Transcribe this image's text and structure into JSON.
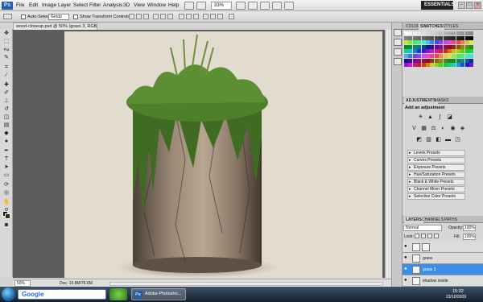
{
  "app": {
    "logo": "Ps"
  },
  "menu": [
    "File",
    "Edit",
    "Image",
    "Layer",
    "Select",
    "Filter",
    "Analysis",
    "3D",
    "View",
    "Window",
    "Help"
  ],
  "top_toolbar": {
    "zoom": "33%",
    "workspace": "ESSENTIALS ▾",
    "window_buttons": [
      "–",
      "□",
      "×"
    ]
  },
  "options_bar": {
    "auto_select_label": "Auto-Select:",
    "auto_select_value": "Group",
    "transform_label": "Show Transform Controls"
  },
  "document": {
    "tab_title": "wood-closeup.psd @ 50% (grass 3, RGB/8) *",
    "zoom": "50%",
    "doc_info": "Doc: 10.8M/76.6M"
  },
  "panels": {
    "color_tabs": [
      "COLOR",
      "SWATCHES",
      "STYLES"
    ],
    "active_color_tab": "SWATCHES",
    "adjust_tabs": [
      "ADJUSTMENTS",
      "MASKS"
    ],
    "adjust_title": "Add an adjustment",
    "presets": [
      "Levels Presets",
      "Curves Presets",
      "Exposure Presets",
      "Hue/Saturation Presets",
      "Black & White Presets",
      "Channel Mixer Presets",
      "Selective Color Presets"
    ],
    "layers_tabs": [
      "LAYERS",
      "CHANNELS",
      "PATHS"
    ],
    "blend_mode": "Normal",
    "opacity_label": "Opacity:",
    "opacity_value": "100%",
    "lock_label": "Lock:",
    "fill_label": "Fill:",
    "fill_value": "100%",
    "layers": [
      {
        "name": "",
        "selected": false
      },
      {
        "name": "grass",
        "selected": false
      },
      {
        "name": "grass 3",
        "selected": true
      },
      {
        "name": "shadow inside",
        "selected": false
      }
    ]
  },
  "taskbar": {
    "search_brand": "Google",
    "active_app": "Adobe Photosho...",
    "time": "15:32",
    "date": "23/10/2009"
  },
  "colors": {
    "selection": "#3c8ee6",
    "canvas_bg": "#e2dcce",
    "workspace": "#5d5d5d"
  }
}
